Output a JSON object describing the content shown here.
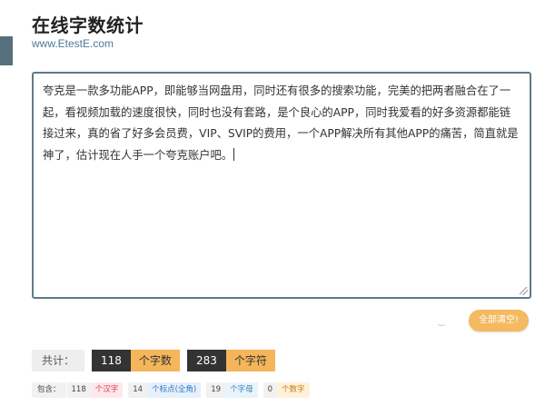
{
  "header": {
    "title": "在线字数统计",
    "url": "www.EtestE.com"
  },
  "editor": {
    "text": "夸克是一款多功能APP，即能够当网盘用，同时还有很多的搜索功能，完美的把两者融合在了一起，看视频加载的速度很快，同时也没有套路，是个良心的APP，同时我爱看的好多资源都能链接过来，真的省了好多会员费，VIP、SVIP的费用，一个APP解决所有其他APP的痛苦，简直就是神了，估计现在人手一个夸克账户吧。"
  },
  "actions": {
    "clear_label": "全部清空!"
  },
  "summary": {
    "label": "共计：",
    "char_count": "118",
    "char_unit": "个字数",
    "symbol_count": "283",
    "symbol_unit": "个字符"
  },
  "details": {
    "label": "包含：",
    "han_count": "118",
    "han_unit": "个汉字",
    "punct_count": "14",
    "punct_unit": "个标点(全角)",
    "letter_count": "19",
    "letter_unit": "个字母",
    "digit_count": "0",
    "digit_unit": "个数字"
  },
  "colors": {
    "accent": "#f5b55a",
    "dark": "#333333",
    "border": "#5f7a86"
  }
}
